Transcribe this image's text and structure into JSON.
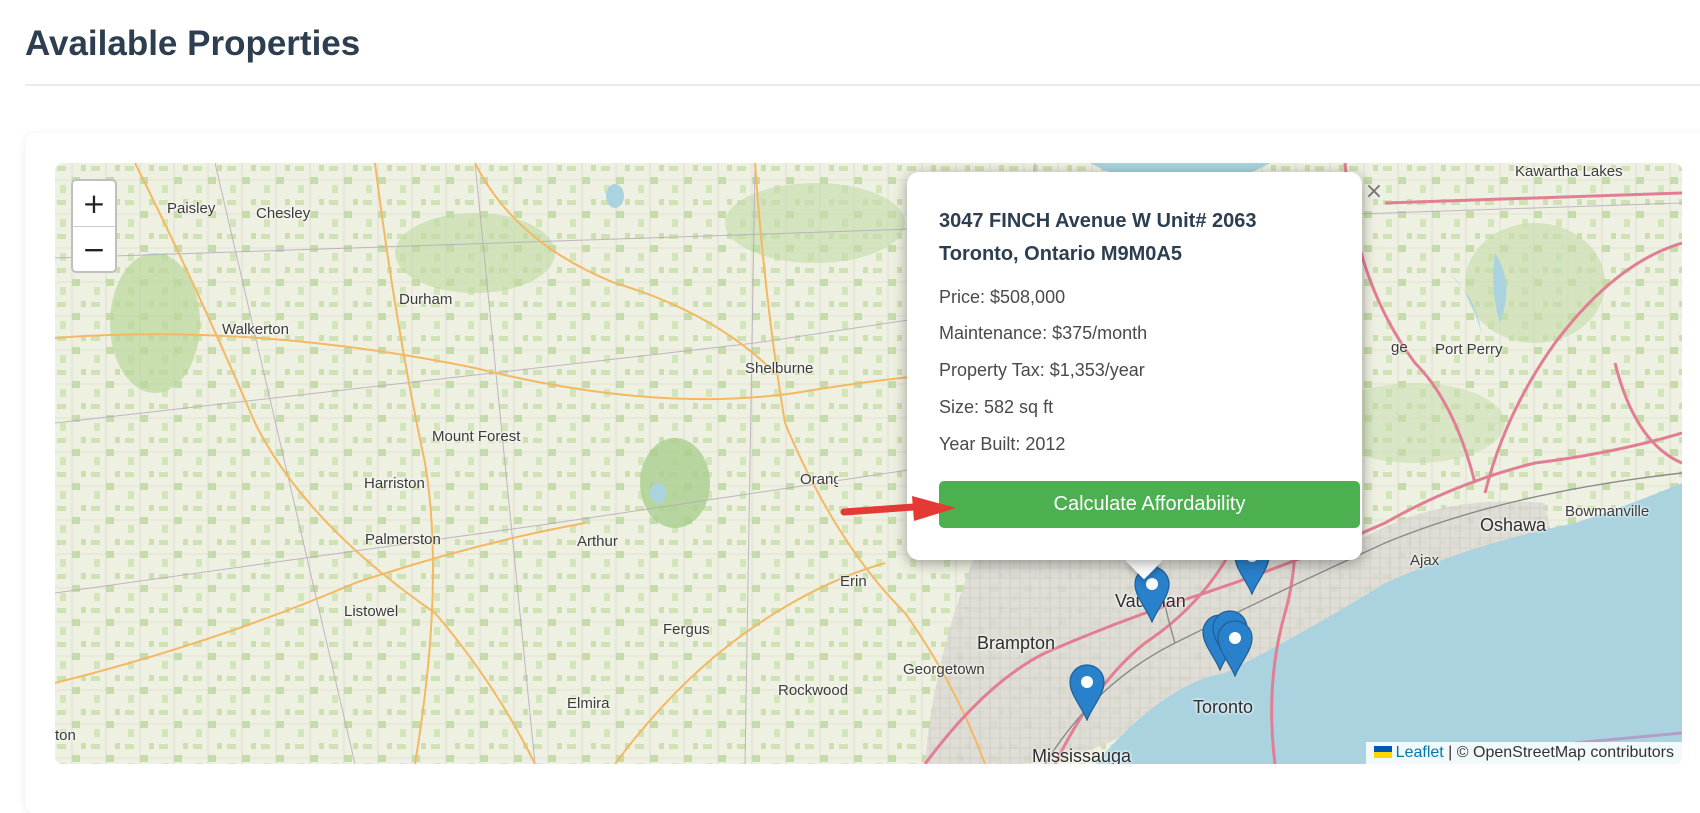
{
  "page": {
    "title": "Available Properties"
  },
  "map": {
    "zoom_in_label": "+",
    "zoom_out_label": "−",
    "places": [
      {
        "id": "paisley",
        "name": "Paisley"
      },
      {
        "id": "chesley",
        "name": "Chesley"
      },
      {
        "id": "durham",
        "name": "Durham"
      },
      {
        "id": "walkerton",
        "name": "Walkerton"
      },
      {
        "id": "shelburne",
        "name": "Shelburne"
      },
      {
        "id": "mount-forest",
        "name": "Mount Forest"
      },
      {
        "id": "harriston",
        "name": "Harriston"
      },
      {
        "id": "orangeville",
        "name": "Orangeville"
      },
      {
        "id": "palmerston",
        "name": "Palmerston"
      },
      {
        "id": "arthur",
        "name": "Arthur"
      },
      {
        "id": "listowel",
        "name": "Listowel"
      },
      {
        "id": "erin",
        "name": "Erin"
      },
      {
        "id": "fergus",
        "name": "Fergus"
      },
      {
        "id": "brampton",
        "name": "Brampton"
      },
      {
        "id": "georgetown",
        "name": "Georgetown"
      },
      {
        "id": "rockwood",
        "name": "Rockwood"
      },
      {
        "id": "elmira",
        "name": "Elmira"
      },
      {
        "id": "mississauga",
        "name": "Mississauga"
      },
      {
        "id": "toronto",
        "name": "Toronto"
      },
      {
        "id": "vaughan",
        "name": "Vaughan"
      },
      {
        "id": "ajax",
        "name": "Ajax"
      },
      {
        "id": "oshawa",
        "name": "Oshawa"
      },
      {
        "id": "bowmanville",
        "name": "Bowmanville"
      },
      {
        "id": "port-perry",
        "name": "Port Perry"
      },
      {
        "id": "kawartha-lakes",
        "name": "Kawartha Lakes"
      },
      {
        "id": "stratford-partial",
        "name": "ton"
      },
      {
        "id": "uxbridge-partial",
        "name": "ge"
      }
    ],
    "marker_count": 6,
    "attribution": {
      "leaflet_label": "Leaflet",
      "separator": " | ",
      "osm_text": "© OpenStreetMap contributors",
      "flag_colors": [
        "#0057b7",
        "#ffd700"
      ]
    }
  },
  "popup": {
    "close_label": "×",
    "address_line1": "3047 FINCH Avenue W Unit# 2063",
    "address_line2": "Toronto, Ontario M9M0A5",
    "details": {
      "price": "Price: $508,000",
      "maintenance": "Maintenance: $375/month",
      "tax": "Property Tax: $1,353/year",
      "size": "Size: 582 sq ft",
      "year": "Year Built: 2012"
    },
    "button_label": "Calculate Affordability"
  },
  "colors": {
    "title": "#2c3e50",
    "button": "#4caf50",
    "marker": "#2a81cb",
    "arrow": "#e53935",
    "water": "#aad3df",
    "land": "#efeee6"
  }
}
